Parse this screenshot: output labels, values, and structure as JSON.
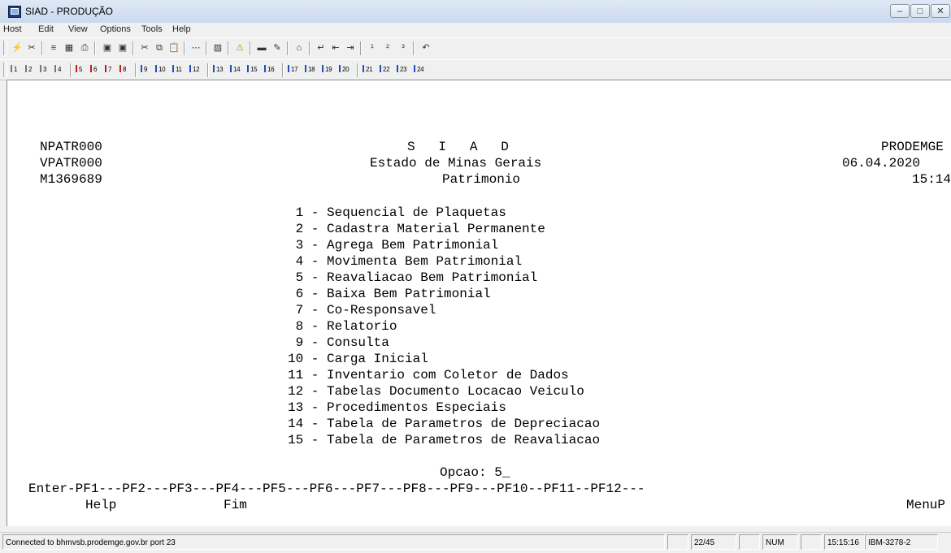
{
  "window": {
    "title": "SIAD - PRODUÇÃO"
  },
  "menubar": {
    "items": [
      "Host",
      "Edit",
      "View",
      "Options",
      "Tools",
      "Help"
    ]
  },
  "toolbar2": {
    "keys": [
      "1",
      "2",
      "3",
      "4",
      "5",
      "6",
      "7",
      "8",
      "9",
      "10",
      "11",
      "12",
      "13",
      "14",
      "15",
      "16",
      "17",
      "18",
      "19",
      "20",
      "21",
      "22",
      "23",
      "24"
    ]
  },
  "terminal": {
    "header_left": [
      "NPATR000",
      "VPATR000",
      "M1369689"
    ],
    "header_center": [
      "S   I   A   D",
      "Estado de Minas Gerais",
      "Patrimonio"
    ],
    "header_right": [
      "PRODEMGE",
      "06.04.2020",
      "15:14"
    ],
    "menu_options": [
      " 1 - Sequencial de Plaquetas",
      " 2 - Cadastra Material Permanente",
      " 3 - Agrega Bem Patrimonial",
      " 4 - Movimenta Bem Patrimonial",
      " 5 - Reavaliacao Bem Patrimonial",
      " 6 - Baixa Bem Patrimonial",
      " 7 - Co-Responsavel",
      " 8 - Relatorio",
      " 9 - Consulta",
      "10 - Carga Inicial",
      "11 - Inventario com Coletor de Dados",
      "12 - Tabelas Documento Locacao Veiculo",
      "13 - Procedimentos Especiais",
      "14 - Tabela de Parametros de Depreciacao",
      "15 - Tabela de Parametros de Reavaliacao"
    ],
    "option_prompt": "Opcao: 5_",
    "pf_line": "Enter-PF1---PF2---PF3---PF4---PF5---PF6---PF7---PF8---PF9---PF10--PF11--PF12---",
    "pf_help": "Help",
    "pf_fim": "Fim",
    "pf_menup": "MenuP"
  },
  "statusbar": {
    "connection": "Connected to bhmvsb.prodemge.gov.br port 23",
    "cursor": "22/45",
    "num": "NUM",
    "time": "15:15:16",
    "terminal_type": "IBM-3278-2"
  }
}
